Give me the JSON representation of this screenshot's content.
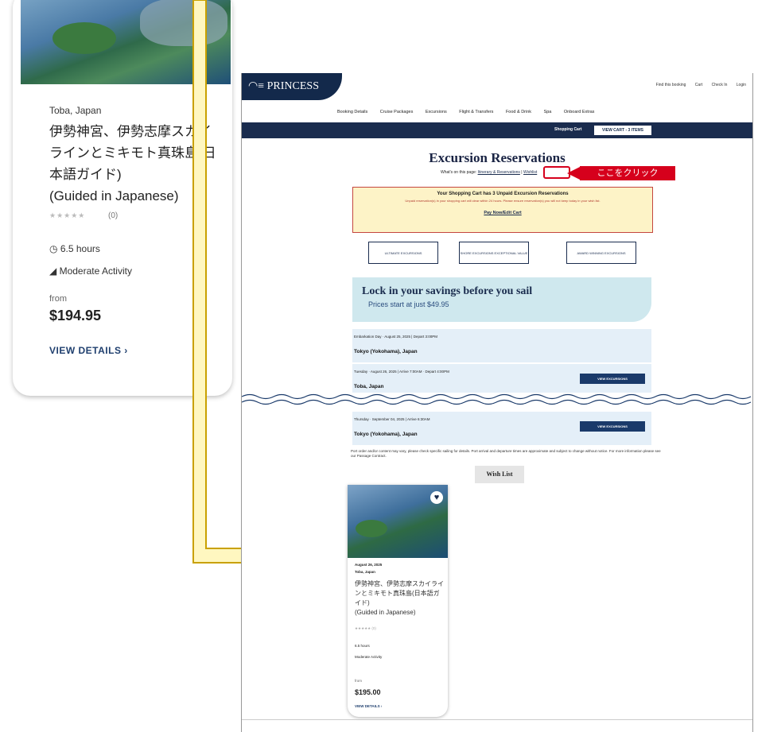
{
  "zoom_card": {
    "port": "Toba, Japan",
    "title": "伊勢神宮、伊勢志摩スカイラインとミキモト真珠島(日本語ガイド)",
    "title_en": "(Guided in Japanese)",
    "stars": "★★★★★",
    "rating_count": "(0)",
    "duration": "6.5 hours",
    "activity": "Moderate Activity",
    "from_label": "from",
    "price": "$194.95",
    "view_details": "VIEW DETAILS ›"
  },
  "site": {
    "logo": "PRINCESS",
    "top_links": [
      "Find this booking",
      "Cart",
      "Check In",
      "Login"
    ],
    "nav": [
      "Booking Details",
      "Cruise Packages",
      "Excursions",
      "Flight & Transfers",
      "Food & Drink",
      "Spa",
      "Onboard Extras"
    ],
    "cart_label": "Shopping Cart",
    "cart_button": "VIEW CART - 3 ITEMS"
  },
  "page": {
    "title": "Excursion Reservations",
    "on_page_label": "What's on this page:",
    "on_page_link1": "Itinerary & Reservations",
    "on_page_link2": "Wishlist",
    "callout": "ここをクリック"
  },
  "unpaid": {
    "heading": "Your Shopping Cart has 3 Unpaid Excursion Reservations",
    "detail": "Unpaid reservation(s) in your shopping cart will clear within 24 hours. Please ensure reservation(s) you will not keep today in your wish list.",
    "link": "Pay Now/Edit Cart"
  },
  "badges": [
    "ULTIMATE EXCURSIONS",
    "SHORE EXCURSIONS EXCEPTIONAL VALUE",
    "AWARD WINNING EXCURSIONS"
  ],
  "lockin": {
    "heading": "Lock in your savings before you sail",
    "sub": "Prices start at just $49.95"
  },
  "ports": [
    {
      "meta": "Embarkation Day · August 25, 2025 | Depart 3:00PM",
      "name": "Tokyo (Yokohama), Japan",
      "button": ""
    },
    {
      "meta": "Tuesday · August 26, 2025 | Arrive 7:00AM · Depart 4:00PM",
      "name": "Toba, Japan",
      "button": "VIEW EXCURSIONS"
    },
    {
      "meta": "Thursday · September 04, 2025 | Arrive 6:30AM",
      "name": "Tokyo (Yokohama), Japan",
      "button": "VIEW EXCURSIONS"
    }
  ],
  "note": "Port order and/or content may vary, please check specific sailing for details. Port arrival and departure times are approximate and subject to change without notice. For more information please see our Passage Contract.",
  "wishlist_button": "Wish List",
  "small_card": {
    "date": "August 26, 2025",
    "port": "Toba, Japan",
    "title": "伊勢神宮、伊勢志摩スカイラインとミキモト真珠島(日本語ガイド)",
    "title_en": "(Guided in Japanese)",
    "stars": "★★★★★ (0)",
    "duration": "6.5 hours",
    "activity": "Moderate Activity",
    "from_label": "from",
    "price": "$195.00",
    "view_details": "VIEW DETAILS ›"
  },
  "colors": {
    "navy": "#13294b",
    "callout_red": "#d6001c",
    "arrow_yellow": "#fff7c0",
    "lockin_bg": "#cfe8ee"
  }
}
